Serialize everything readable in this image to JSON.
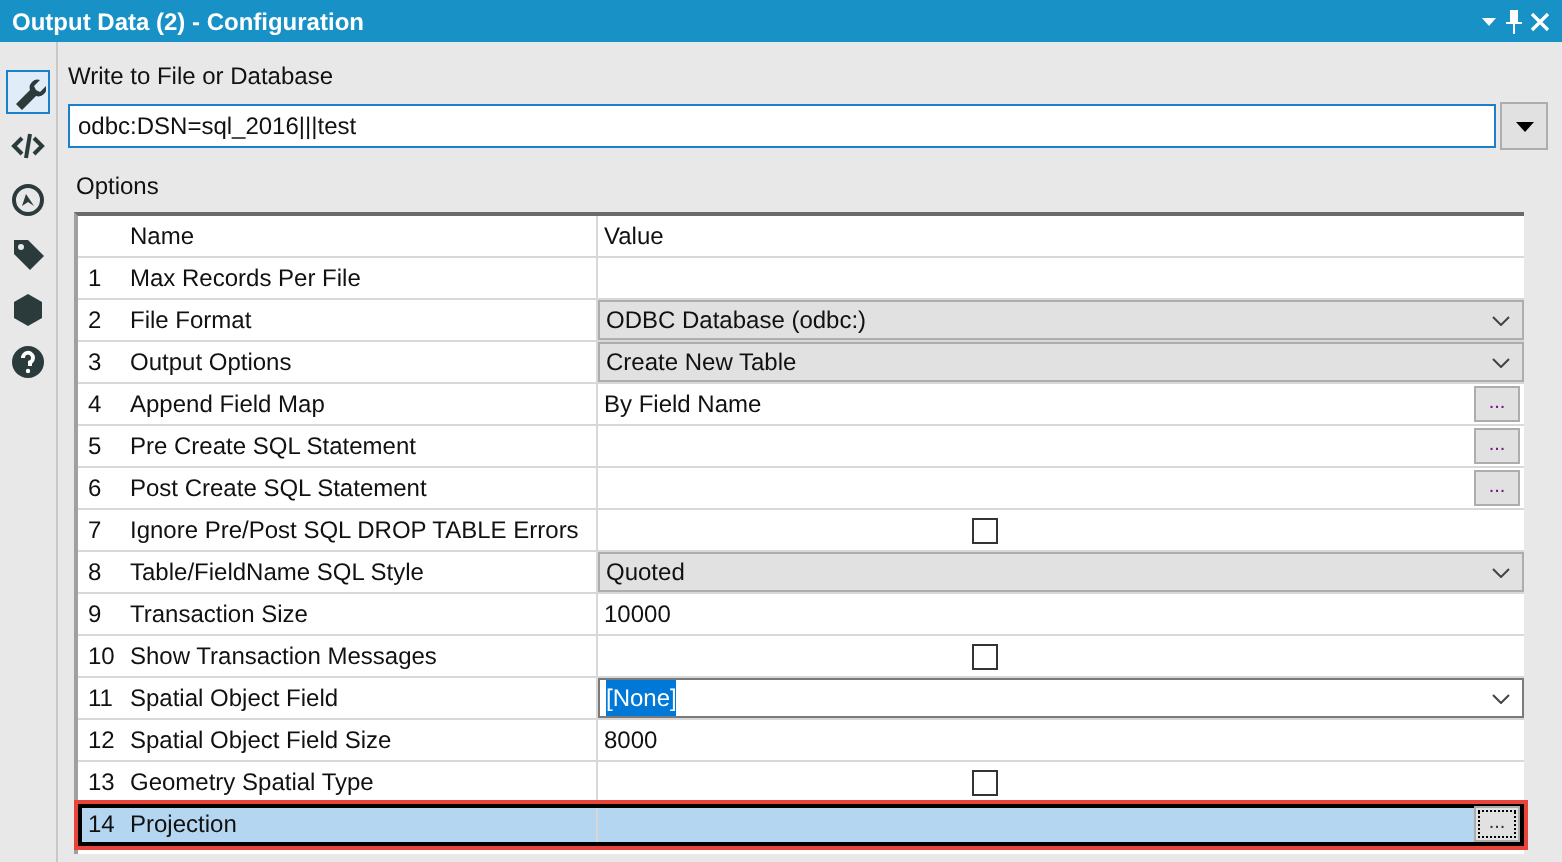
{
  "window": {
    "title": "Output Data (2) - Configuration"
  },
  "sidebar": {
    "items": [
      {
        "kind": "wrench",
        "selected": true
      },
      {
        "kind": "code",
        "selected": false
      },
      {
        "kind": "compass",
        "selected": false
      },
      {
        "kind": "tag",
        "selected": false
      },
      {
        "kind": "box",
        "selected": false
      },
      {
        "kind": "help",
        "selected": false
      }
    ]
  },
  "destination": {
    "label": "Write to File or Database",
    "value": "odbc:DSN=sql_2016|||test"
  },
  "options": {
    "label": "Options",
    "columns": [
      "Name",
      "Value"
    ],
    "rows": [
      {
        "number": "1",
        "name": "Max Records Per File",
        "kind": "text",
        "value": "",
        "selected": false
      },
      {
        "number": "2",
        "name": "File Format",
        "kind": "dropdown",
        "value": "ODBC Database (odbc:)",
        "selected": false
      },
      {
        "number": "3",
        "name": "Output Options",
        "kind": "dropdown",
        "value": "Create New Table",
        "selected": false
      },
      {
        "number": "4",
        "name": "Append Field Map",
        "kind": "button",
        "value": "By Field Name",
        "button": "...",
        "selected": false
      },
      {
        "number": "5",
        "name": "Pre Create SQL Statement",
        "kind": "button",
        "value": "",
        "button": "...",
        "selected": false
      },
      {
        "number": "6",
        "name": "Post Create SQL Statement",
        "kind": "button",
        "value": "",
        "button": "...",
        "selected": false
      },
      {
        "number": "7",
        "name": "Ignore Pre/Post SQL DROP TABLE Errors",
        "kind": "checkbox",
        "checked": false,
        "selected": false
      },
      {
        "number": "8",
        "name": "Table/FieldName SQL Style",
        "kind": "dropdown",
        "value": "Quoted",
        "selected": false
      },
      {
        "number": "9",
        "name": "Transaction Size",
        "kind": "text",
        "value": "10000",
        "selected": false
      },
      {
        "number": "10",
        "name": "Show Transaction Messages",
        "kind": "checkbox",
        "checked": false,
        "selected": false
      },
      {
        "number": "11",
        "name": "Spatial Object Field",
        "kind": "combo",
        "value": "[None]",
        "selected": false
      },
      {
        "number": "12",
        "name": "Spatial Object Field Size",
        "kind": "text",
        "value": "8000",
        "selected": false
      },
      {
        "number": "13",
        "name": "Geometry Spatial Type",
        "kind": "checkbox",
        "checked": false,
        "selected": false
      },
      {
        "number": "14",
        "name": "Projection",
        "kind": "button",
        "value": "",
        "button": "...",
        "selected": true
      }
    ]
  }
}
